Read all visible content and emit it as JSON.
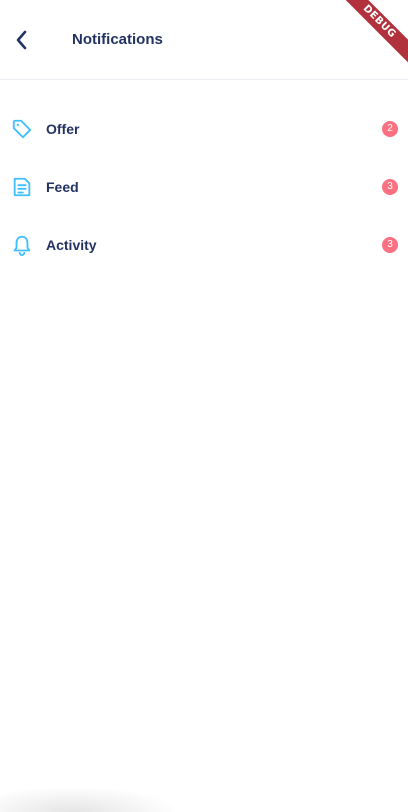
{
  "header": {
    "title": "Notifications",
    "back_icon": "chevron-left-icon"
  },
  "debug_banner": "DEBUG",
  "notifications": [
    {
      "label": "Offer",
      "count": "2",
      "icon": "tag-icon"
    },
    {
      "label": "Feed",
      "count": "3",
      "icon": "document-icon"
    },
    {
      "label": "Activity",
      "count": "3",
      "icon": "bell-icon"
    }
  ],
  "colors": {
    "primary_text": "#223263",
    "accent": "#40bfff",
    "badge": "#fb7181",
    "divider": "#ebedf3"
  }
}
